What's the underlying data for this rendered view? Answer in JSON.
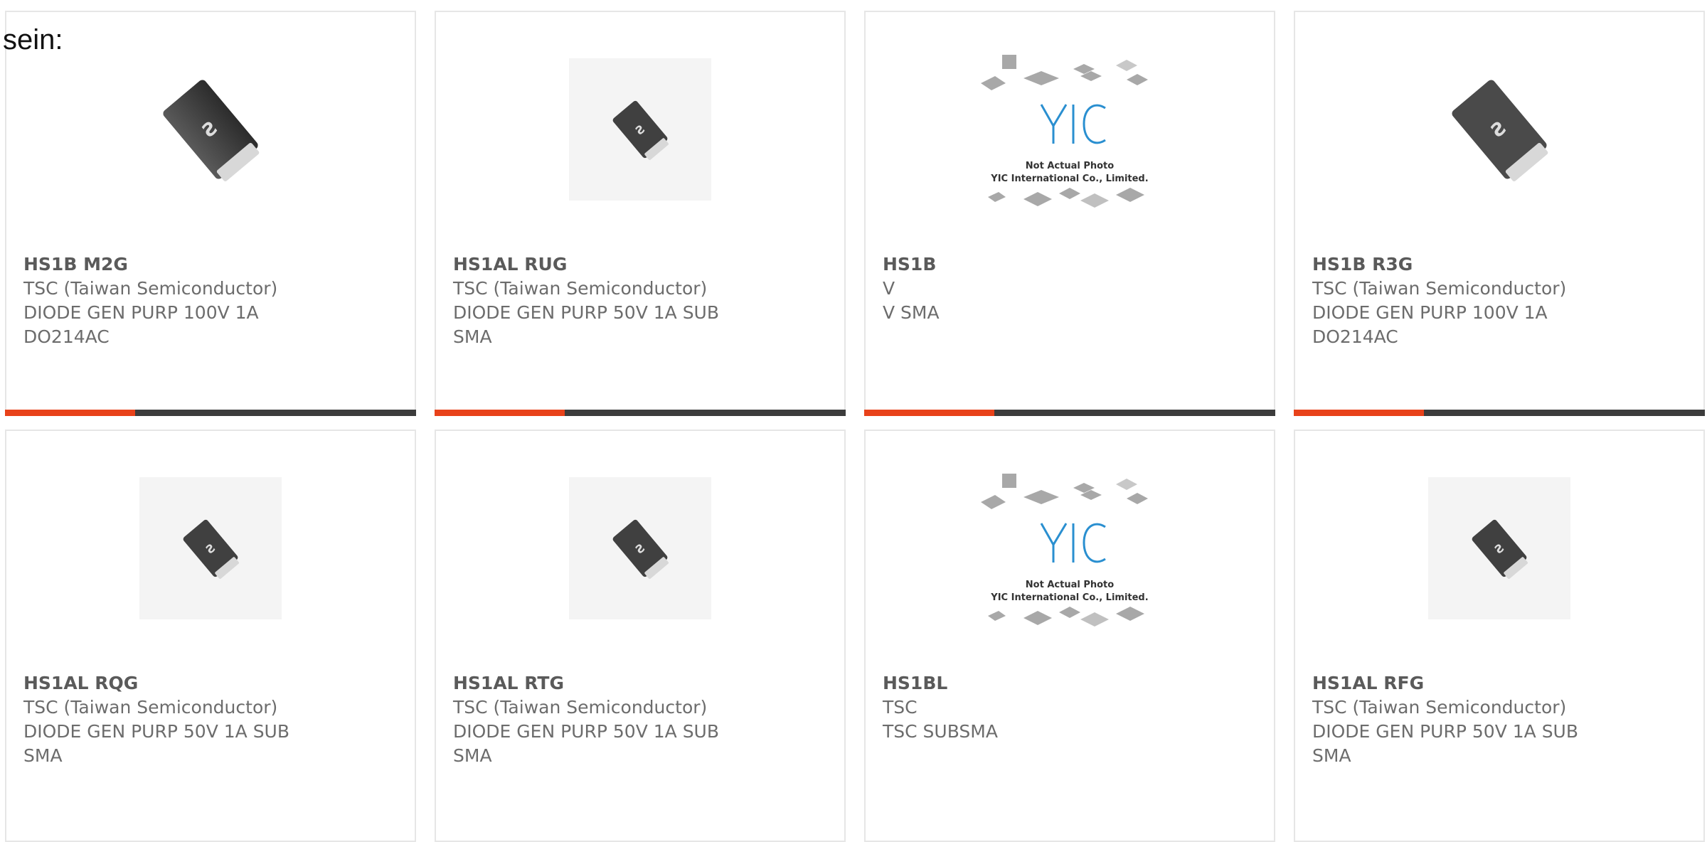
{
  "intro_text": "sein:",
  "colors": {
    "accent_bar": "#e8421a",
    "dark_bar": "#3c3c3c",
    "card_border": "#e6e6e6",
    "text_muted": "#6c6c6c",
    "yic_logo": "#2a8fd0"
  },
  "yic_photo": {
    "logo": "YIC",
    "line1": "Not Actual Photo",
    "line2": "YIC International Co., Limited."
  },
  "products": [
    {
      "part": "HS1B M2G",
      "maker": "TSC (Taiwan Semiconductor)",
      "desc1": "DIODE GEN PURP 100V 1A",
      "desc2": "DO214AC",
      "image": "diode-large-icon"
    },
    {
      "part": "HS1AL RUG",
      "maker": "TSC (Taiwan Semiconductor)",
      "desc1": "DIODE GEN PURP 50V 1A SUB",
      "desc2": "SMA",
      "image": "diode-small-icon"
    },
    {
      "part": "HS1B",
      "maker": "V",
      "desc1": "V SMA",
      "desc2": "",
      "image": "placeholder-photo"
    },
    {
      "part": "HS1B R3G",
      "maker": "TSC (Taiwan Semiconductor)",
      "desc1": "DIODE GEN PURP 100V 1A",
      "desc2": "DO214AC",
      "image": "diode-large-icon"
    },
    {
      "part": "HS1AL RQG",
      "maker": "TSC (Taiwan Semiconductor)",
      "desc1": "DIODE GEN PURP 50V 1A SUB",
      "desc2": "SMA",
      "image": "diode-small-icon"
    },
    {
      "part": "HS1AL RTG",
      "maker": "TSC (Taiwan Semiconductor)",
      "desc1": "DIODE GEN PURP 50V 1A SUB",
      "desc2": "SMA",
      "image": "diode-small-icon"
    },
    {
      "part": "HS1BL",
      "maker": "TSC",
      "desc1": "TSC SUBSMA",
      "desc2": "",
      "image": "placeholder-photo"
    },
    {
      "part": "HS1AL RFG",
      "maker": "TSC (Taiwan Semiconductor)",
      "desc1": "DIODE GEN PURP 50V 1A SUB",
      "desc2": "SMA",
      "image": "diode-small-icon"
    }
  ]
}
